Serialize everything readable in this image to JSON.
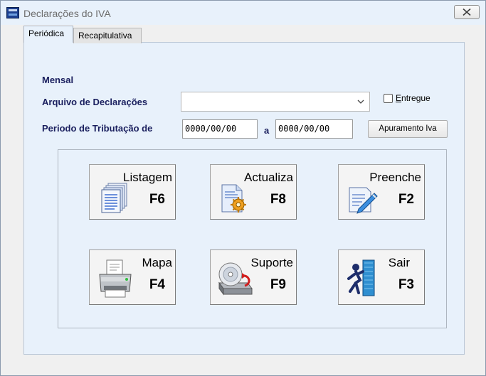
{
  "window": {
    "title": "Declarações do IVA"
  },
  "tabs": [
    {
      "label": "Periódica"
    },
    {
      "label": "Recapitulativa"
    }
  ],
  "form": {
    "mensal_label": "Mensal",
    "arquivo_label": "Arquivo de Declarações",
    "arquivo_value": "",
    "entregue_label": "Entregue",
    "periodo_label": "Periodo de Tributação de",
    "date_from": "0000/00/00",
    "date_sep": "a",
    "date_to": "0000/00/00",
    "apuramento_label": "Apuramento Iva"
  },
  "buttons": {
    "listagem": {
      "caption": "Listagem",
      "key": "F6"
    },
    "actualiza": {
      "caption": "Actualiza",
      "key": "F8"
    },
    "preenche": {
      "caption": "Preenche",
      "key": "F2"
    },
    "mapa": {
      "caption": "Mapa",
      "key": "F4"
    },
    "suporte": {
      "caption": "Suporte",
      "key": "F9"
    },
    "sair": {
      "caption": "Sair",
      "key": "F3"
    }
  },
  "colors": {
    "label_text": "#1a1f5e",
    "panel_bg": "#e8f1fb",
    "window_bg": "#f0f0f0"
  }
}
